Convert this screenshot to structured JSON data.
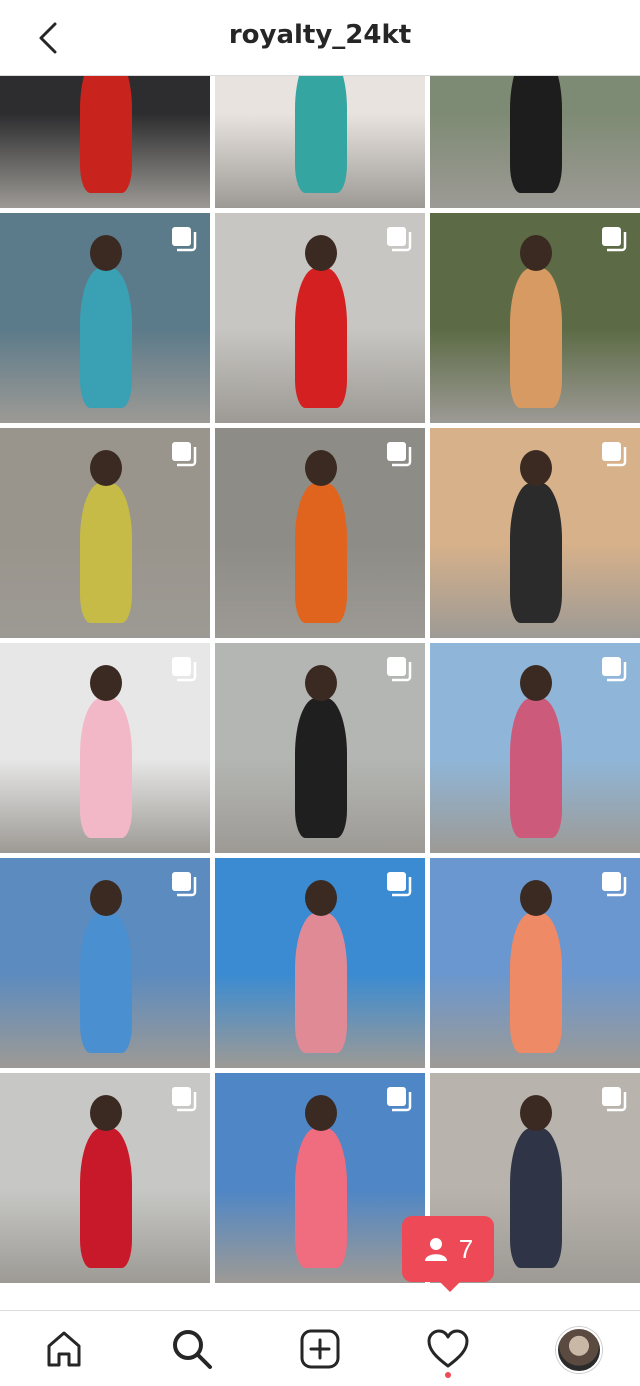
{
  "header": {
    "title": "royalty_24kt",
    "back_icon": "chevron-left-icon"
  },
  "grid": {
    "posts": [
      {
        "index": 0,
        "multi": false,
        "bg": "#2d2d2f",
        "accent": "#c9231d"
      },
      {
        "index": 1,
        "multi": false,
        "bg": "#e8e3df",
        "accent": "#34a5a0"
      },
      {
        "index": 2,
        "multi": false,
        "bg": "#7e8b74",
        "accent": "#1d1d1d"
      },
      {
        "index": 3,
        "multi": true,
        "bg": "#5b7a8a",
        "accent": "#3aa1b5"
      },
      {
        "index": 4,
        "multi": true,
        "bg": "#c8c6c2",
        "accent": "#d42020"
      },
      {
        "index": 5,
        "multi": true,
        "bg": "#5c6b45",
        "accent": "#d89a63"
      },
      {
        "index": 6,
        "multi": true,
        "bg": "#9a958c",
        "accent": "#c6bb47"
      },
      {
        "index": 7,
        "multi": true,
        "bg": "#8e8c87",
        "accent": "#e0641d"
      },
      {
        "index": 8,
        "multi": true,
        "bg": "#d7b18a",
        "accent": "#2b2b2b"
      },
      {
        "index": 9,
        "multi": true,
        "bg": "#e7e7e7",
        "accent": "#f2b8c8"
      },
      {
        "index": 10,
        "multi": true,
        "bg": "#b4b6b3",
        "accent": "#1f1f1f"
      },
      {
        "index": 11,
        "multi": true,
        "bg": "#8fb6d8",
        "accent": "#cc5a7a"
      },
      {
        "index": 12,
        "multi": true,
        "bg": "#5c8bbf",
        "accent": "#4a8fd0"
      },
      {
        "index": 13,
        "multi": true,
        "bg": "#3a8bd2",
        "accent": "#e08a96"
      },
      {
        "index": 14,
        "multi": true,
        "bg": "#6a97cf",
        "accent": "#ef8a66"
      },
      {
        "index": 15,
        "multi": true,
        "bg": "#c7c8c5",
        "accent": "#c8192a"
      },
      {
        "index": 16,
        "multi": true,
        "bg": "#4e86c6",
        "accent": "#ef6d7e"
      },
      {
        "index": 17,
        "multi": true,
        "bg": "#b8b3ac",
        "accent": "#2f3446"
      }
    ]
  },
  "notification": {
    "icon": "person-icon",
    "count": "7",
    "color": "#ed4956"
  },
  "bottom_nav": {
    "items": [
      {
        "name": "home-icon"
      },
      {
        "name": "search-icon"
      },
      {
        "name": "new-post-icon"
      },
      {
        "name": "activity-heart-icon"
      },
      {
        "name": "profile-avatar"
      }
    ]
  }
}
